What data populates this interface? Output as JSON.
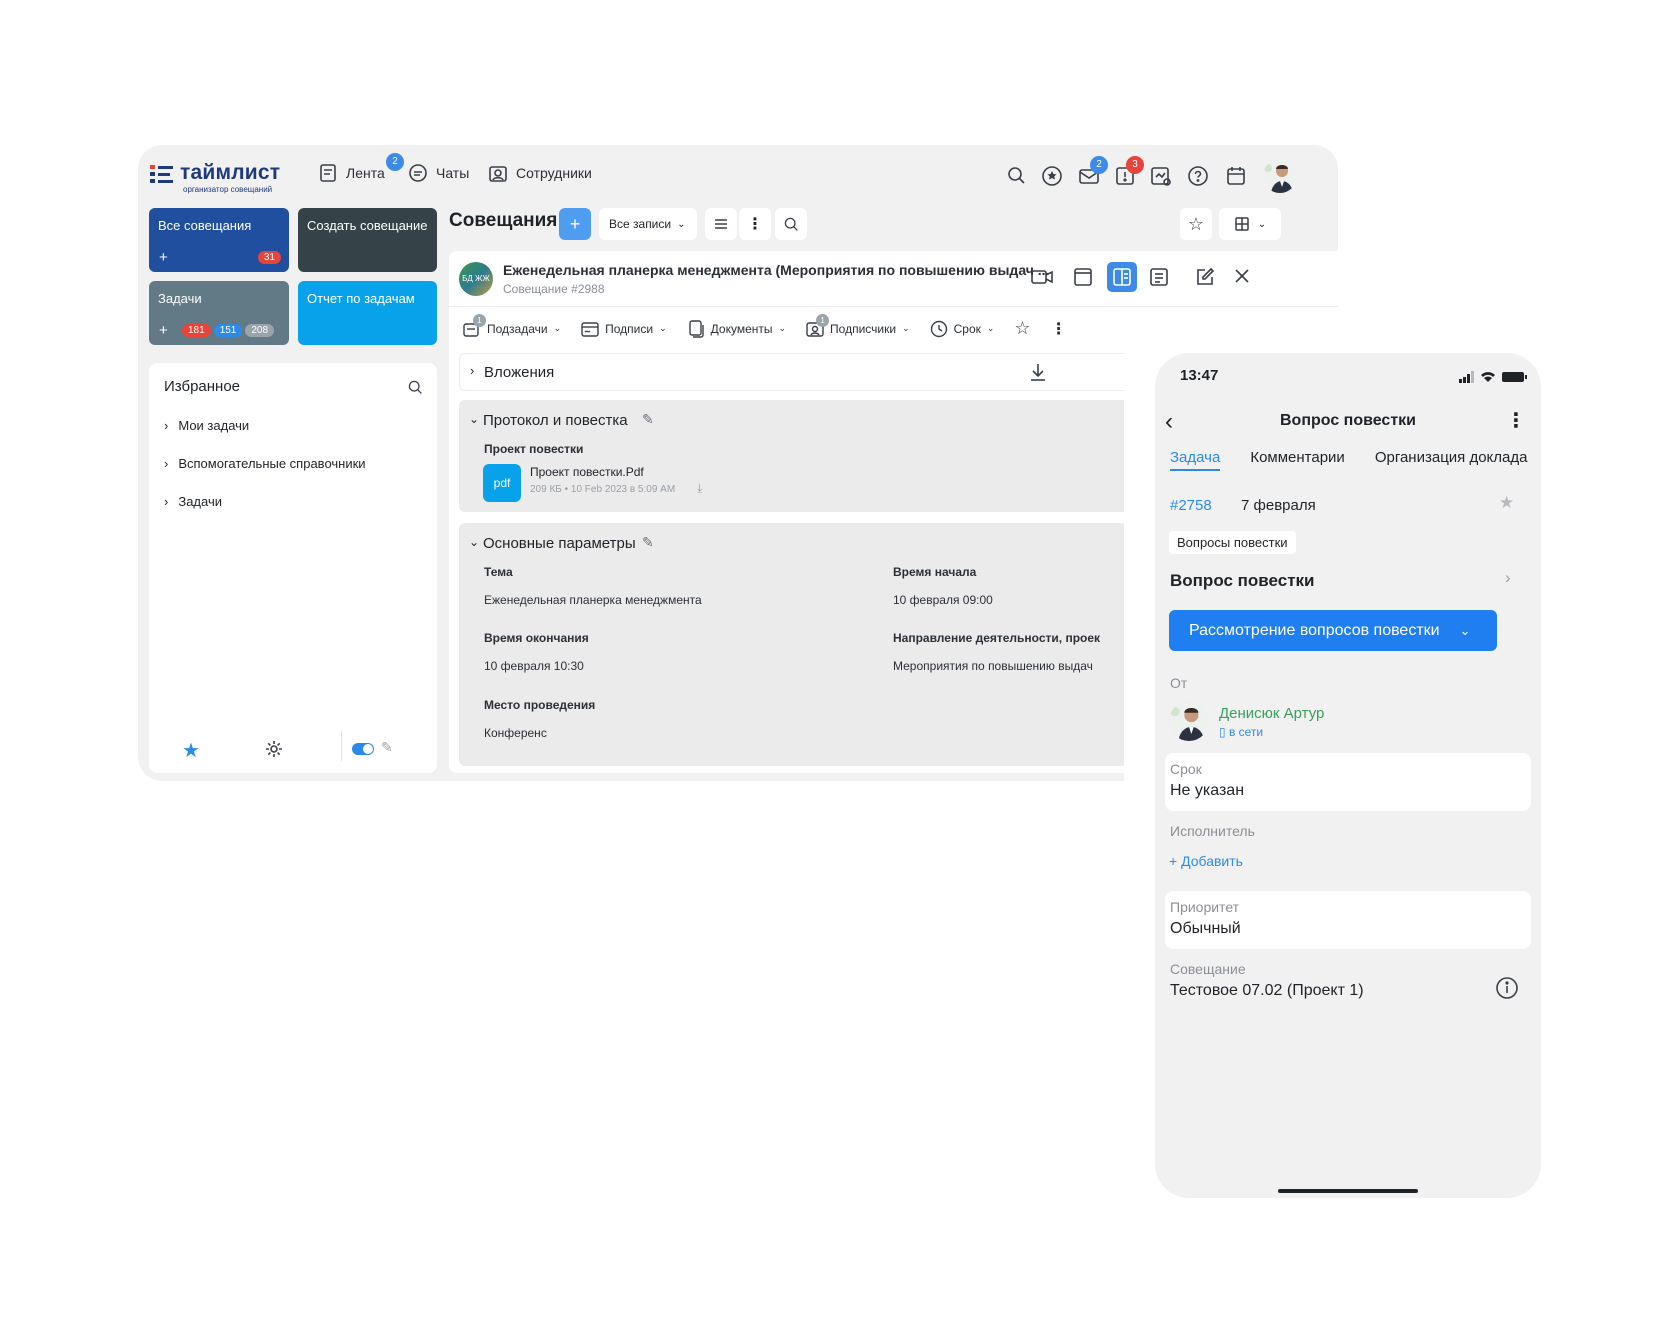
{
  "brand": {
    "name": "таймлист",
    "tagline": "организатор совещаний"
  },
  "topnav": {
    "feed": {
      "label": "Лента",
      "badge": "2"
    },
    "chats": {
      "label": "Чаты"
    },
    "staff": {
      "label": "Сотрудники"
    },
    "icons": {
      "mail_badge": "2",
      "alerts_badge": "3"
    }
  },
  "sidebar": {
    "tile_all": {
      "label": "Все совещания",
      "count": "31"
    },
    "tile_create": {
      "label": "Создать совещание"
    },
    "tile_tasks": {
      "label": "Задачи",
      "counts": [
        "181",
        "151",
        "208"
      ]
    },
    "tile_report": {
      "label": "Отчет по задачам"
    },
    "favorites": {
      "title": "Избранное",
      "items": [
        "Мои задачи",
        "Вспомогательные справочники",
        "Задачи"
      ]
    }
  },
  "main": {
    "title": "Совещания",
    "filter_label": "Все записи",
    "meeting": {
      "avatar_initials": "БД ЖЖ",
      "title": "Еженедельная планерка менеджмента (Мероприятия по повышению выдач ...",
      "subtitle": "Совещание",
      "number": "#2988"
    },
    "tabs": [
      {
        "label": "Подзадачи",
        "badge": "1"
      },
      {
        "label": "Подписи"
      },
      {
        "label": "Документы"
      },
      {
        "label": "Подписчики",
        "badge": "1"
      },
      {
        "label": "Срок"
      }
    ],
    "attachments_title": "Вложения",
    "protocol": {
      "title": "Протокол и повестка",
      "field_label": "Проект повестки",
      "file_type": "pdf",
      "file_name": "Проект повестки.Pdf",
      "file_meta": "209 КБ • 10 Feb 2023 в 5:09 AM"
    },
    "params": {
      "title": "Основные параметры",
      "topic_label": "Тема",
      "topic_value": "Еженедельная планерка менеджмента",
      "start_label": "Время начала",
      "start_value": "10 февраля 09:00",
      "end_label": "Время окончания",
      "end_value": "10 февраля 10:30",
      "direction_label": "Направление деятельности, проек",
      "direction_value": "Мероприятия по повышению выдач",
      "place_label": "Место проведения",
      "place_value": "Конференс"
    }
  },
  "phone": {
    "time": "13:47",
    "title": "Вопрос повестки",
    "tabs": [
      "Задача",
      "Комментарии",
      "Организация доклада"
    ],
    "task_number": "#2758",
    "task_date": "7 февраля",
    "tag": "Вопросы повестки",
    "heading": "Вопрос повестки",
    "status_button": "Рассмотрение вопросов повестки",
    "from_label": "От",
    "from_name": "Денисюк Артур",
    "from_status": "в сети",
    "deadline_label": "Срок",
    "deadline_value": "Не указан",
    "assignee_label": "Исполнитель",
    "assignee_add": "+ Добавить",
    "priority_label": "Приоритет",
    "priority_value": "Обычный",
    "meeting_label": "Совещание",
    "meeting_value": "Тестовое 07.02 (Проект 1)"
  },
  "colors": {
    "accent": "#2c8be8",
    "navy_tile": "#1f4f9e",
    "dark_tile": "#354247",
    "gray_tile": "#627a86",
    "cyan_tile": "#08a2ea",
    "badge_red": "#e8443a",
    "link_green": "#3aa05a"
  }
}
